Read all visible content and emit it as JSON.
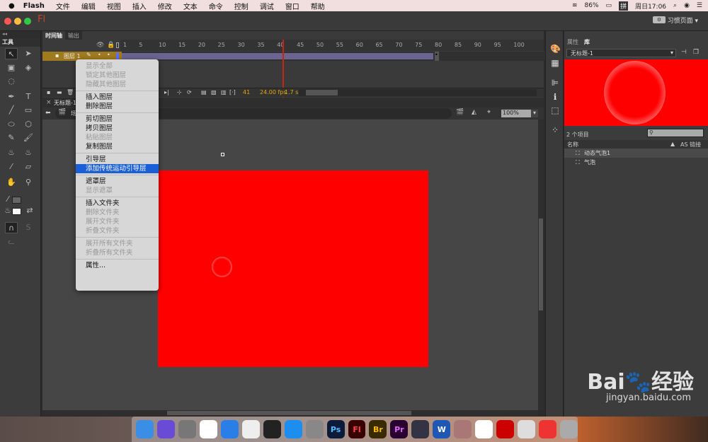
{
  "menubar": {
    "app": "Flash",
    "items": [
      "文件",
      "编辑",
      "视图",
      "插入",
      "修改",
      "文本",
      "命令",
      "控制",
      "调试",
      "窗口",
      "帮助"
    ],
    "battery": "86%",
    "input_method": "拼",
    "clock": "周日17:06"
  },
  "titlebar": {
    "logo": "Fl",
    "workspace": "习惯页面"
  },
  "tools": {
    "tab": "工具"
  },
  "timeline": {
    "tabs": [
      "时间轴",
      "输出"
    ],
    "ruler": [
      "1",
      "5",
      "10",
      "15",
      "20",
      "25",
      "30",
      "35",
      "40",
      "45",
      "50",
      "55",
      "60",
      "65",
      "70",
      "75",
      "80",
      "85",
      "90",
      "95",
      "100"
    ],
    "layer_name": "图层 1",
    "current_frame": "41",
    "fps": "24.00 fps",
    "time": "1.7 s"
  },
  "document": {
    "tab": "无标题-1*",
    "scene": "场景 1",
    "zoom": "100%"
  },
  "context_menu": {
    "items": [
      {
        "label": "显示全部",
        "disabled": true
      },
      {
        "label": "锁定其他图层",
        "disabled": true
      },
      {
        "label": "隐藏其他图层",
        "disabled": true
      },
      {
        "sep": true
      },
      {
        "label": "插入图层"
      },
      {
        "label": "删除图层"
      },
      {
        "sep": true
      },
      {
        "label": "剪切图层"
      },
      {
        "label": "拷贝图层"
      },
      {
        "label": "粘贴图层",
        "disabled": true
      },
      {
        "label": "复制图层"
      },
      {
        "sep": true
      },
      {
        "label": "引导层"
      },
      {
        "label": "添加传统运动引导层",
        "highlighted": true
      },
      {
        "sep": true
      },
      {
        "label": "遮罩层"
      },
      {
        "label": "显示遮罩",
        "disabled": true
      },
      {
        "sep": true
      },
      {
        "label": "插入文件夹"
      },
      {
        "label": "删除文件夹",
        "disabled": true
      },
      {
        "label": "展开文件夹",
        "disabled": true
      },
      {
        "label": "折叠文件夹",
        "disabled": true
      },
      {
        "sep": true
      },
      {
        "label": "展开所有文件夹",
        "disabled": true
      },
      {
        "label": "折叠所有文件夹",
        "disabled": true
      },
      {
        "sep": true
      },
      {
        "label": "属性..."
      }
    ]
  },
  "library": {
    "tabs": [
      "属性",
      "库"
    ],
    "document": "无标题-1",
    "count": "2 个项目",
    "col_name": "名称",
    "col_link": "AS 链接",
    "items": [
      "动态气泡1",
      "气泡"
    ]
  },
  "stage": {
    "color": "#ff0000"
  },
  "dock": {
    "apps": [
      "Finder",
      "Siri",
      "Launchpad",
      "Chrome",
      "Safari",
      "Photos",
      "QQ",
      "App Store",
      "System Preferences",
      "Ps",
      "Fl",
      "Br",
      "Pr",
      "QuickTime",
      "W",
      "Archive",
      "W",
      "Flash Player",
      "Preview",
      "Flash",
      "Trash"
    ]
  },
  "watermark": {
    "brand": "Bai du 经验",
    "url": "jingyan.baidu.com"
  }
}
